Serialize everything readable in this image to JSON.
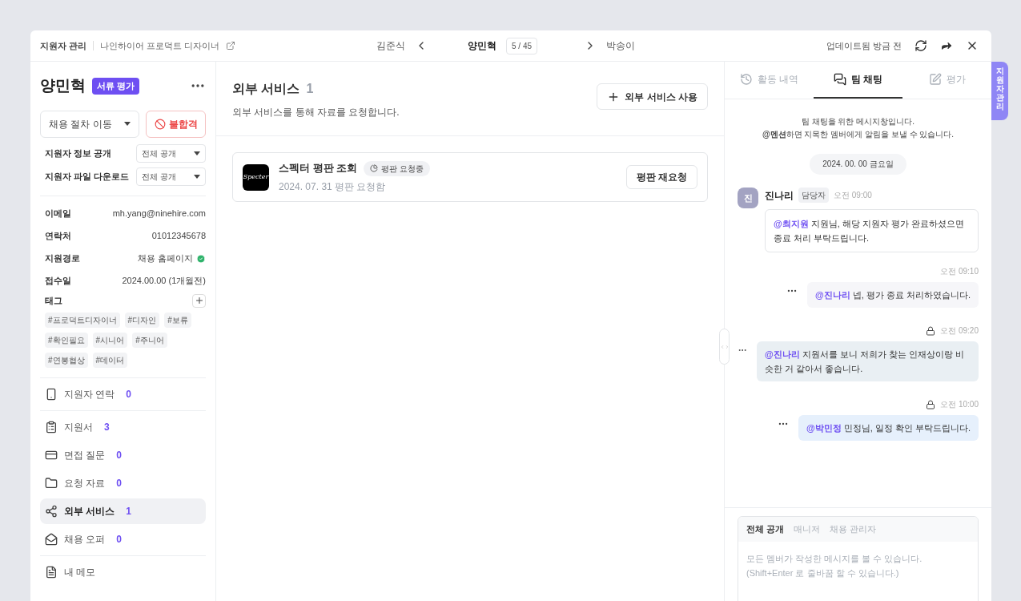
{
  "header": {
    "breadcrumb": "지원자 관리",
    "job": "나인하이어 프로덕트 디자이너",
    "prev": "김준식",
    "current": "양민혁",
    "position": "5 / 45",
    "next": "박송이",
    "updated": "업데이트됨 방금 전"
  },
  "profile": {
    "name": "양민혁",
    "stage": "서류 평가",
    "move_select": "채용 절차 이동",
    "reject_button": "불합격",
    "settings": [
      {
        "label": "지원자 정보 공개",
        "value": "전체 공개"
      },
      {
        "label": "지원자 파일 다운로드",
        "value": "전체 공개"
      }
    ],
    "info": [
      {
        "label": "이메일",
        "value": "mh.yang@ninehire.com",
        "verified": false
      },
      {
        "label": "연락처",
        "value": "01012345678",
        "verified": false
      },
      {
        "label": "지원경로",
        "value": "채용 홈페이지",
        "verified": true
      },
      {
        "label": "접수일",
        "value": "2024.00.00 (1개월전)",
        "verified": false
      }
    ],
    "tags_label": "태그",
    "tags": [
      "#프로덕트디자이너",
      "#디자인",
      "#보류",
      "#확인필요",
      "#시니어",
      "#주니어",
      "#연봉협상",
      "#데이터"
    ]
  },
  "nav_groups": [
    {
      "items": [
        {
          "label": "지원자 연락",
          "count": "0",
          "selected": false
        }
      ]
    },
    {
      "items": [
        {
          "label": "지원서",
          "count": "3",
          "selected": false
        },
        {
          "label": "면접 질문",
          "count": "0",
          "selected": false
        },
        {
          "label": "요청 자료",
          "count": "0",
          "selected": false
        },
        {
          "label": "외부 서비스",
          "count": "1",
          "selected": true
        },
        {
          "label": "채용 오퍼",
          "count": "0",
          "selected": false
        }
      ]
    },
    {
      "items": [
        {
          "label": "내 메모",
          "selected": false
        }
      ]
    }
  ],
  "main": {
    "title": "외부 서비스",
    "count": "1",
    "subtitle": "외부 서비스를 통해 자료를 요청합니다.",
    "add_button": "외부 서비스 사용",
    "services": [
      {
        "logo_text": "Specter",
        "name": "스펙터 평판 조회",
        "status": "평판 요청중",
        "date": "2024. 07. 31 평판 요청함",
        "action": "평판 재요청"
      }
    ]
  },
  "side_tab": "지원자 관리",
  "chat": {
    "tabs": [
      {
        "label": "활동 내역",
        "selected": false
      },
      {
        "label": "팀 채팅",
        "selected": true
      },
      {
        "label": "평가",
        "selected": false
      }
    ],
    "notice": [
      "팀 채팅을 위한 메시지창입니다.",
      "**@멘션**하면 지목한 멤버에게 알림을 보낼 수 있습니다."
    ],
    "date": "2024. 00. 00 금요일",
    "messages": [
      {
        "kind": "other",
        "avatar": "진",
        "author": "진나리",
        "role": "담당자",
        "time": "오전 09:00",
        "color": "#ffffff",
        "text": "**@최지원** 지원님, 해당 지원자 평가 완료하셨으면 종료 처리 부탁드립니다."
      },
      {
        "kind": "mine",
        "time": "오전 09:10",
        "locked": false,
        "color": "#f6f6f9",
        "text": "**@진나리** 넵, 평가 종료 처리하였습니다."
      },
      {
        "kind": "mine",
        "time": "오전 09:20",
        "locked": true,
        "color": "#e9eff3",
        "text": "**@진나리** 지원서를 보니 저희가 찾는 인재상이랑 비슷한 거 같아서 좋습니다."
      },
      {
        "kind": "mine",
        "time": "오전 10:00",
        "locked": true,
        "color": "#e6f0fc",
        "text": "**@박민정** 민정님, 일정 확인 부탁드립니다."
      }
    ],
    "composer": {
      "tabs": [
        {
          "label": "전체 공개",
          "selected": true
        },
        {
          "label": "매니저",
          "selected": false
        },
        {
          "label": "채용 관리자",
          "selected": false
        }
      ],
      "placeholder": "모든 멤버가 작성한 메시지를 볼 수 있습니다.\n(Shift+Enter 로 줄바꿈 할 수 있습니다.)"
    }
  }
}
